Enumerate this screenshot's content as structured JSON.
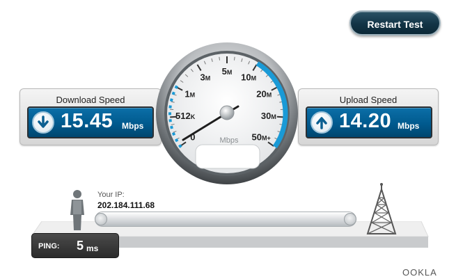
{
  "toolbar": {
    "restart_label": "Restart Test"
  },
  "download": {
    "title": "Download Speed",
    "value": "15.45",
    "unit": "Mbps",
    "icon": "arrow-down-icon"
  },
  "upload": {
    "title": "Upload Speed",
    "value": "14.20",
    "unit": "Mbps",
    "icon": "arrow-up-icon"
  },
  "gauge": {
    "unit_label": "Mbps",
    "ticks": [
      {
        "label": "0",
        "suffix": ""
      },
      {
        "label": "512",
        "suffix": "K"
      },
      {
        "label": "1",
        "suffix": "M"
      },
      {
        "label": "3",
        "suffix": "M"
      },
      {
        "label": "5",
        "suffix": "M"
      },
      {
        "label": "10",
        "suffix": "M"
      },
      {
        "label": "20",
        "suffix": "M"
      },
      {
        "label": "30",
        "suffix": "M"
      },
      {
        "label": "50",
        "suffix": "M+"
      }
    ],
    "accent": "#1a9ad6"
  },
  "connection": {
    "ip_label": "Your IP:",
    "ip_value": "202.184.111.68"
  },
  "ping": {
    "label": "PING:",
    "value": "5",
    "unit": "ms"
  },
  "brand": {
    "logo_text": "OOKLA"
  }
}
